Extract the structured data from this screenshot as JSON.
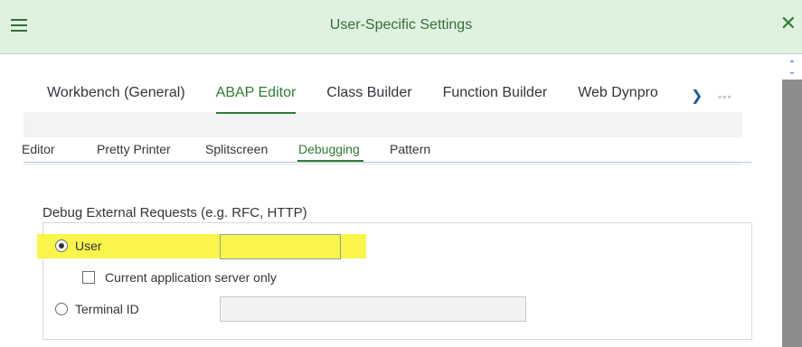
{
  "window": {
    "title": "User-Specific Settings"
  },
  "icons": {
    "menu": "hamburger-icon",
    "close": "close-icon",
    "more": "chevron-right-icon",
    "overflow": "ellipsis-icon",
    "scroll_up": "chevron-up-icon"
  },
  "main_tabs": [
    {
      "label": "Workbench (General)",
      "active": false
    },
    {
      "label": "ABAP Editor",
      "active": true
    },
    {
      "label": "Class Builder",
      "active": false
    },
    {
      "label": "Function Builder",
      "active": false
    },
    {
      "label": "Web Dynpro",
      "active": false
    }
  ],
  "main_tabs_overflow": "◦◦◦",
  "sub_tabs": [
    {
      "label": "Editor",
      "active": false
    },
    {
      "label": "Pretty Printer",
      "active": false
    },
    {
      "label": "Splitscreen",
      "active": false
    },
    {
      "label": "Debugging",
      "active": true
    },
    {
      "label": "Pattern",
      "active": false
    }
  ],
  "debug_group": {
    "title": "Debug External Requests (e.g. RFC, HTTP)",
    "options": {
      "user": {
        "label": "User",
        "selected": true,
        "value": ""
      },
      "current_server_only": {
        "label": "Current application server only",
        "checked": false
      },
      "terminal_id": {
        "label": "Terminal ID",
        "selected": false,
        "value": ""
      }
    }
  },
  "colors": {
    "accent": "#2f7c33",
    "highlight": "#f9f54a",
    "titlebar": "#dff2e0",
    "link": "#1f5c9e"
  }
}
